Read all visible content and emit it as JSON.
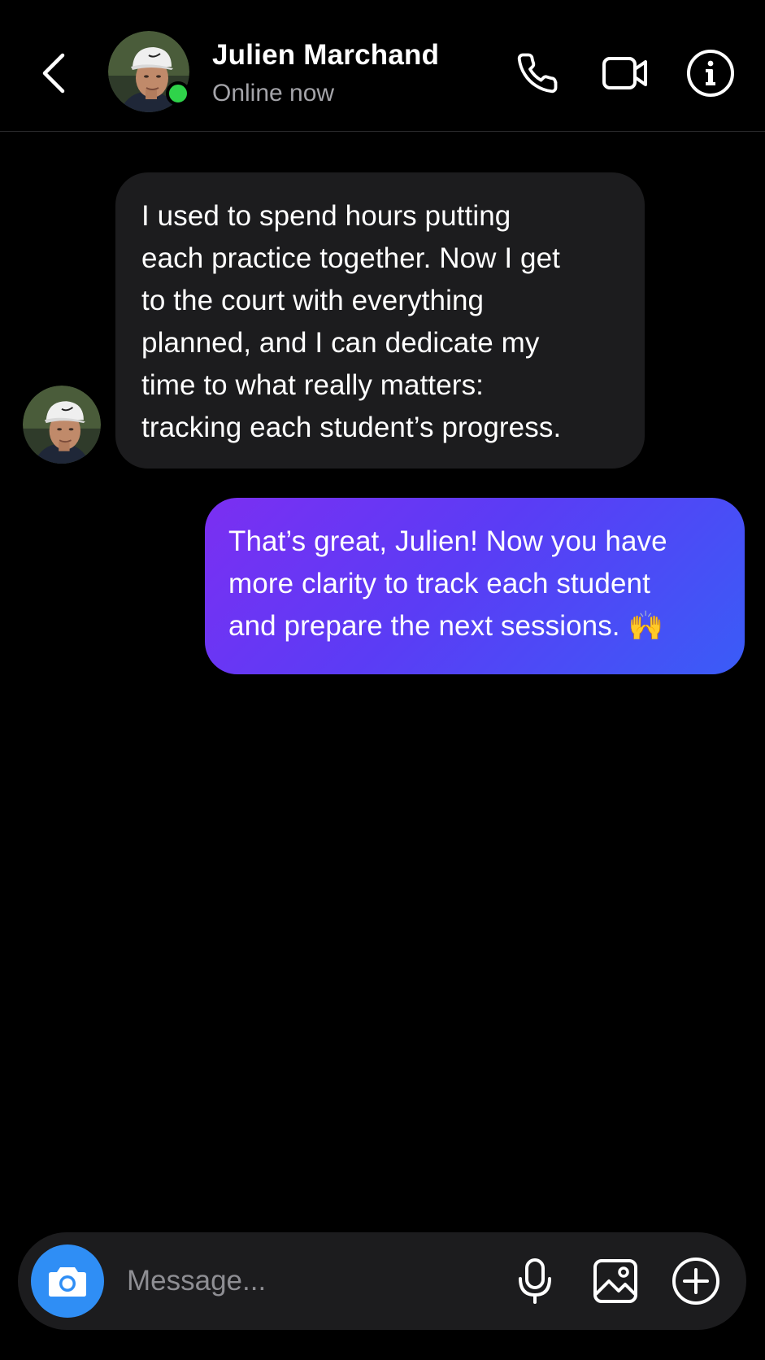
{
  "header": {
    "contact_name": "Julien Marchand",
    "status": "Online now",
    "online_color": "#2fd34a",
    "icons": {
      "back": "chevron-left-icon",
      "call": "phone-icon",
      "video": "video-camera-icon",
      "info": "info-icon"
    }
  },
  "messages": [
    {
      "direction": "incoming",
      "lines": [
        "I used to spend hours putting",
        "each practice together. Now I get",
        "to the court with everything",
        "planned, and I can dedicate my",
        "time to what really matters:",
        "tracking each student’s progress."
      ],
      "bubble_color": "#1c1c1e"
    },
    {
      "direction": "outgoing",
      "lines": [
        "That’s great, Julien! Now you have",
        "more clarity to track each student",
        "and prepare the next sessions. 🙌"
      ],
      "bubble_gradient": [
        "#7b2ff2",
        "#3a5cf7"
      ]
    }
  ],
  "composer": {
    "placeholder": "Message...",
    "value": "",
    "camera_color": "#2f8ef5",
    "icons": {
      "camera": "camera-icon",
      "mic": "microphone-icon",
      "gallery": "image-icon",
      "more": "plus-circle-icon"
    }
  }
}
